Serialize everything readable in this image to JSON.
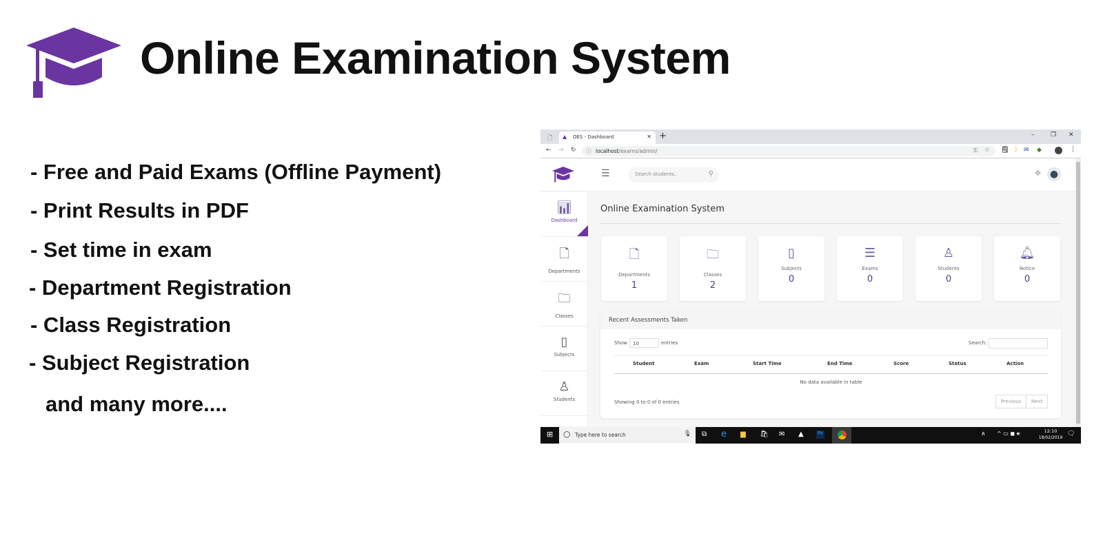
{
  "header": {
    "title": "Online Examination System",
    "logo_icon": "graduation-cap-icon",
    "brand_color": "#6a35a0"
  },
  "features": [
    "- Free and Paid Exams (Offline Payment)",
    "- Print Results in PDF",
    "- Set time in exam",
    "- Department Registration",
    "- Class Registration",
    "- Subject Registration",
    "and many more...."
  ],
  "browser": {
    "tab_title": "OES - Dashboard",
    "url_host": "localhost",
    "url_path": "/exams/admin/"
  },
  "app": {
    "search_placeholder": "Search students..",
    "page_title": "Online Examination System",
    "sidebar": [
      {
        "label": "Dashboard",
        "icon": "chart-icon"
      },
      {
        "label": "Departments",
        "icon": "document-icon"
      },
      {
        "label": "Classes",
        "icon": "folder-icon"
      },
      {
        "label": "Subjects",
        "icon": "book-icon"
      },
      {
        "label": "Students",
        "icon": "user-icon"
      }
    ],
    "stats": [
      {
        "label": "Departments",
        "value": "1"
      },
      {
        "label": "Classes",
        "value": "2"
      },
      {
        "label": "Subjects",
        "value": "0"
      },
      {
        "label": "Exams",
        "value": "0"
      },
      {
        "label": "Students",
        "value": "0"
      },
      {
        "label": "Notice",
        "value": "0"
      }
    ],
    "table": {
      "title": "Recent Assessments Taken",
      "show": "Show",
      "entries_value": "10",
      "entries": "entries",
      "search_label": "Search:",
      "columns": [
        "Student",
        "Exam",
        "Start Time",
        "End Time",
        "Score",
        "Status",
        "Action"
      ],
      "empty": "No data available in table",
      "info": "Showing 0 to 0 of 0 entries",
      "prev": "Previous",
      "next": "Next"
    }
  },
  "taskbar": {
    "search_placeholder": "Type here to search",
    "time": "12:10",
    "date": "18/02/2019"
  }
}
